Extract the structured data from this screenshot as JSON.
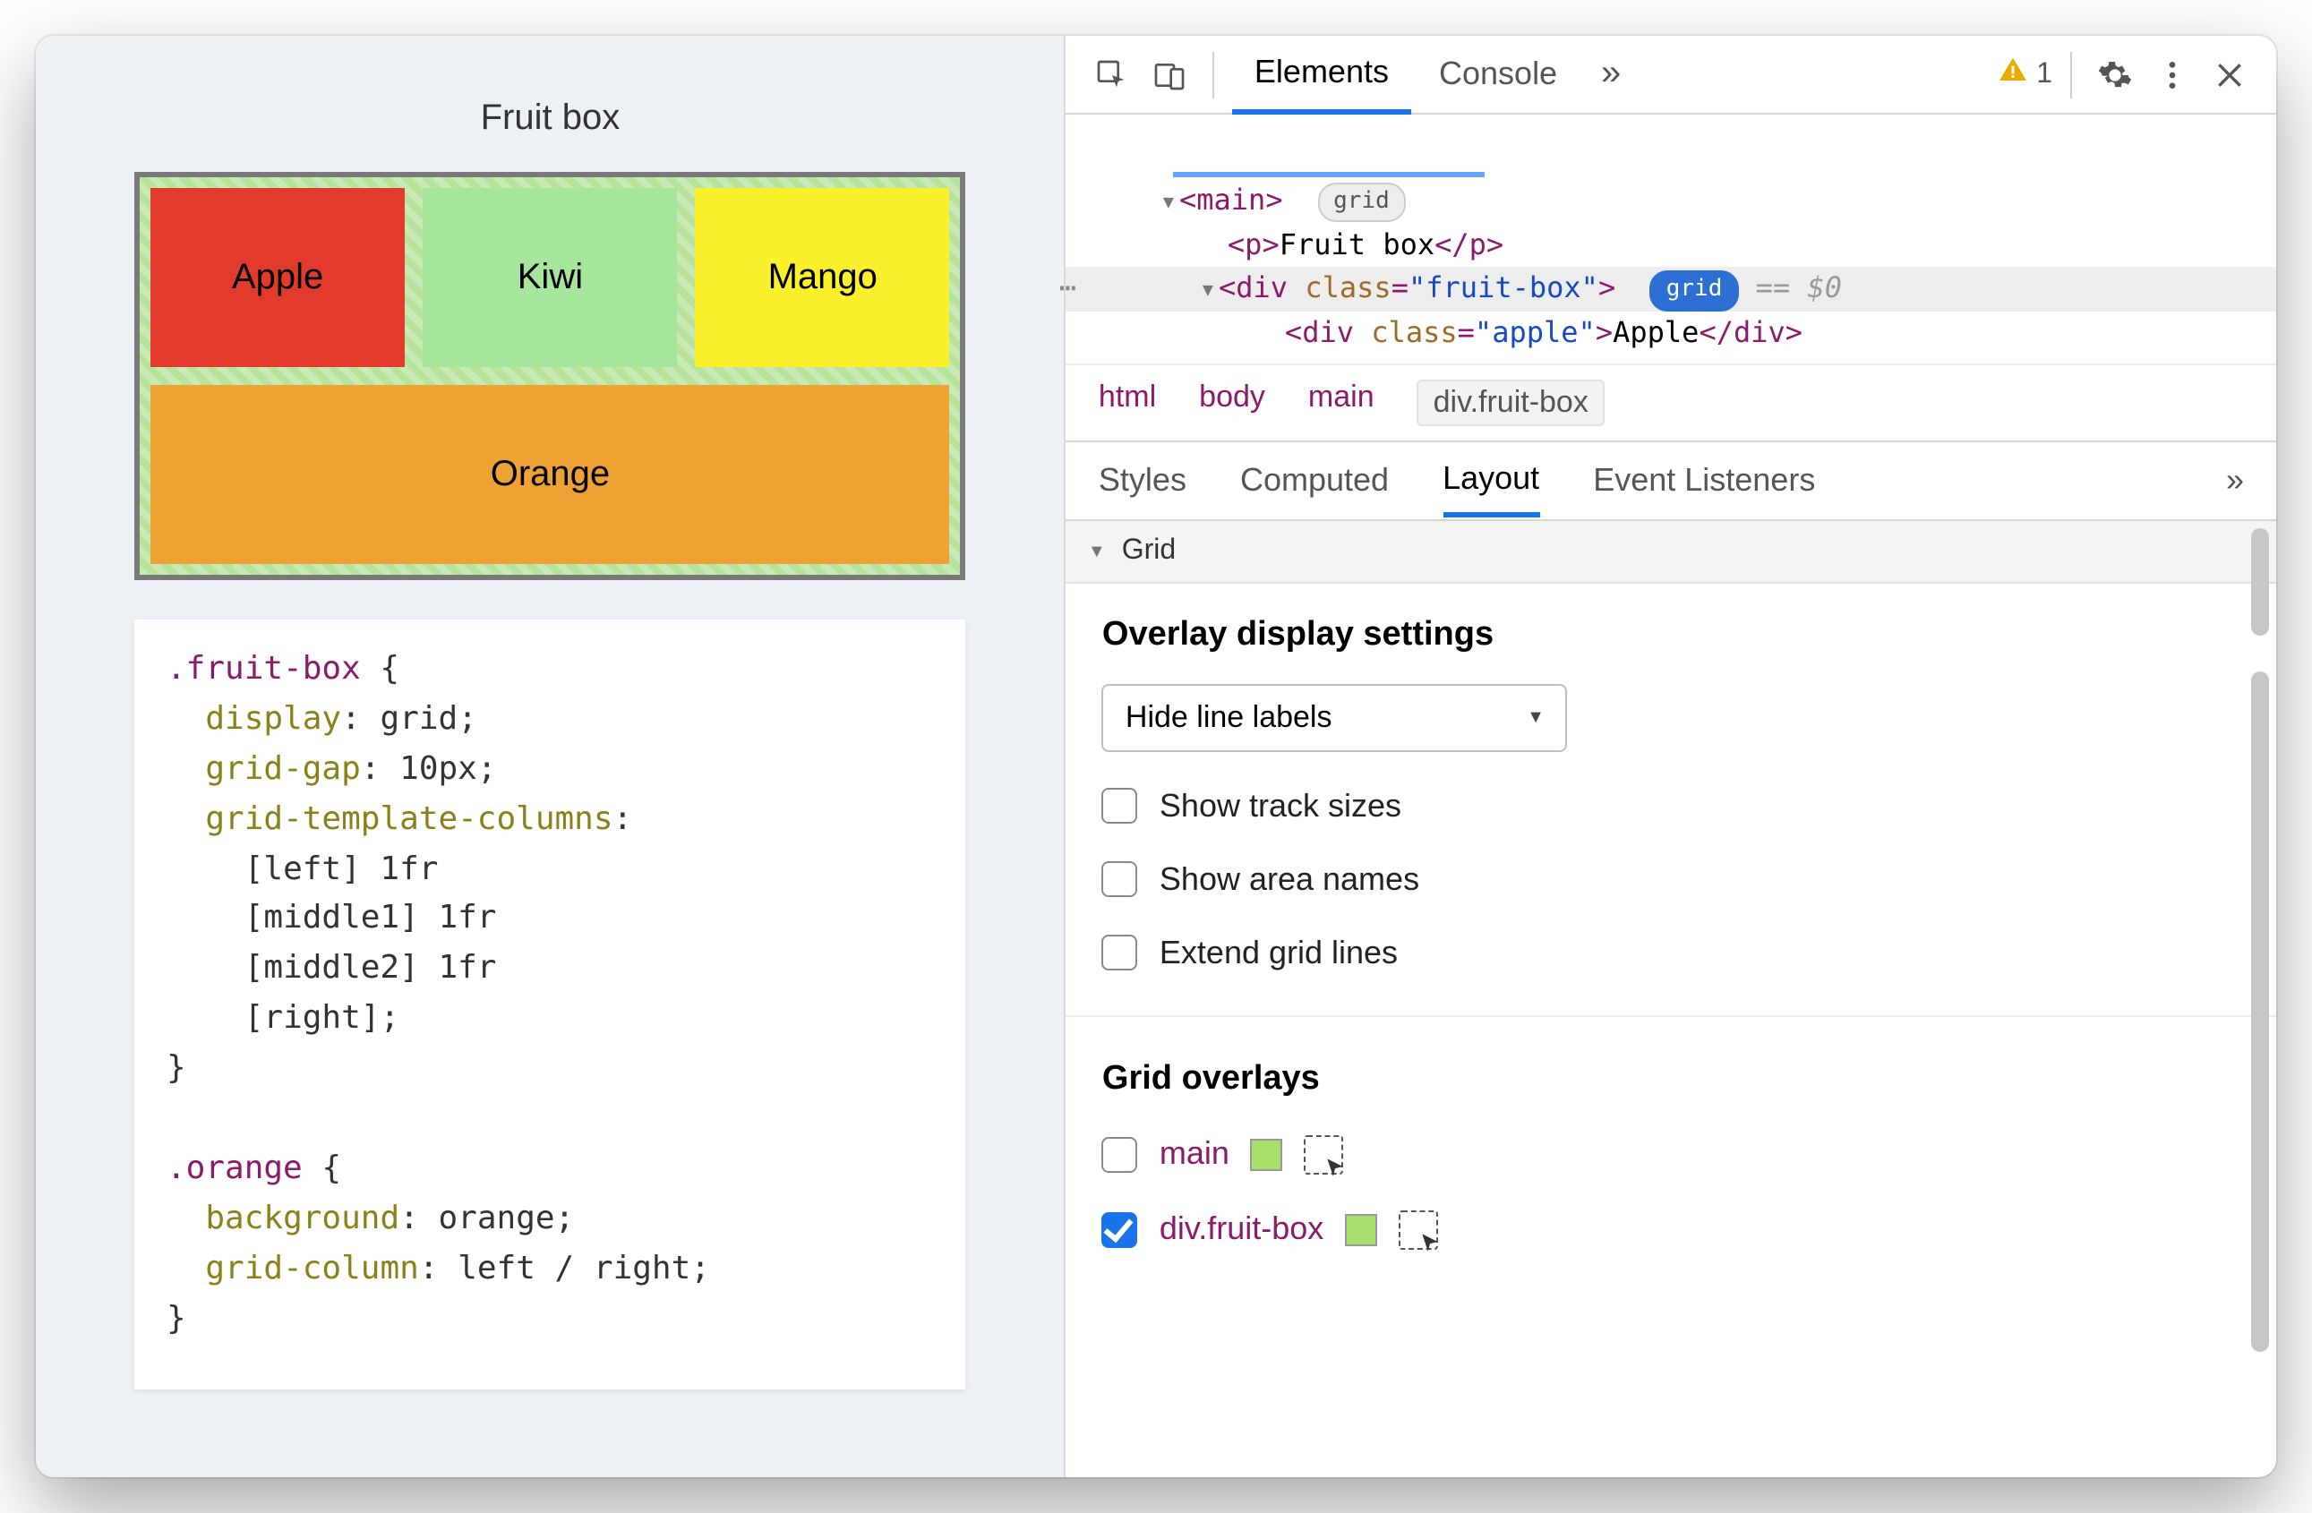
{
  "page": {
    "title": "Fruit box",
    "fruits": {
      "apple": "Apple",
      "kiwi": "Kiwi",
      "mango": "Mango",
      "orange": "Orange"
    },
    "css": {
      "sel1": ".fruit-box",
      "brace_open": " {",
      "p1": "display",
      "v1": "grid",
      "p2": "grid-gap",
      "v2": "10px",
      "p3": "grid-template-columns",
      "l1": "[left] 1fr",
      "l2": "[middle1] 1fr",
      "l3": "[middle2] 1fr",
      "l4": "[right]",
      "brace_close": "}",
      "sel2": ".orange",
      "p4": "background",
      "v4": "orange",
      "p5": "grid-column",
      "v5": "left / right"
    }
  },
  "toolbar": {
    "tabs": {
      "elements": "Elements",
      "console": "Console"
    },
    "warnings": "1"
  },
  "dom": {
    "main_open_a": "<",
    "main_open_b": "main",
    "main_open_c": ">",
    "grid_chip": "grid",
    "p_open": "<p>",
    "p_text": "Fruit box",
    "p_close": "</p>",
    "div_open_a": "<",
    "div_tag": "div",
    "sp": " ",
    "attr_class": "class",
    "eq": "=",
    "q": "\"",
    "fruit_box_val": "fruit-box",
    "gt": ">",
    "eqdollar": " == $0",
    "apple_open_a": "<",
    "apple_tag": "div",
    "apple_attr": "class",
    "apple_val": "apple",
    "apple_text": "Apple",
    "apple_close": "</div>"
  },
  "breadcrumb": {
    "a": "html",
    "b": "body",
    "c": "main",
    "d": "div.fruit-box"
  },
  "subtabs": {
    "styles": "Styles",
    "computed": "Computed",
    "layout": "Layout",
    "events": "Event Listeners"
  },
  "layout": {
    "section": "Grid",
    "overlay_heading": "Overlay display settings",
    "select": "Hide line labels",
    "opt1": "Show track sizes",
    "opt2": "Show area names",
    "opt3": "Extend grid lines",
    "overlays_heading": "Grid overlays",
    "ov1": "main",
    "ov2": "div.fruit-box"
  }
}
